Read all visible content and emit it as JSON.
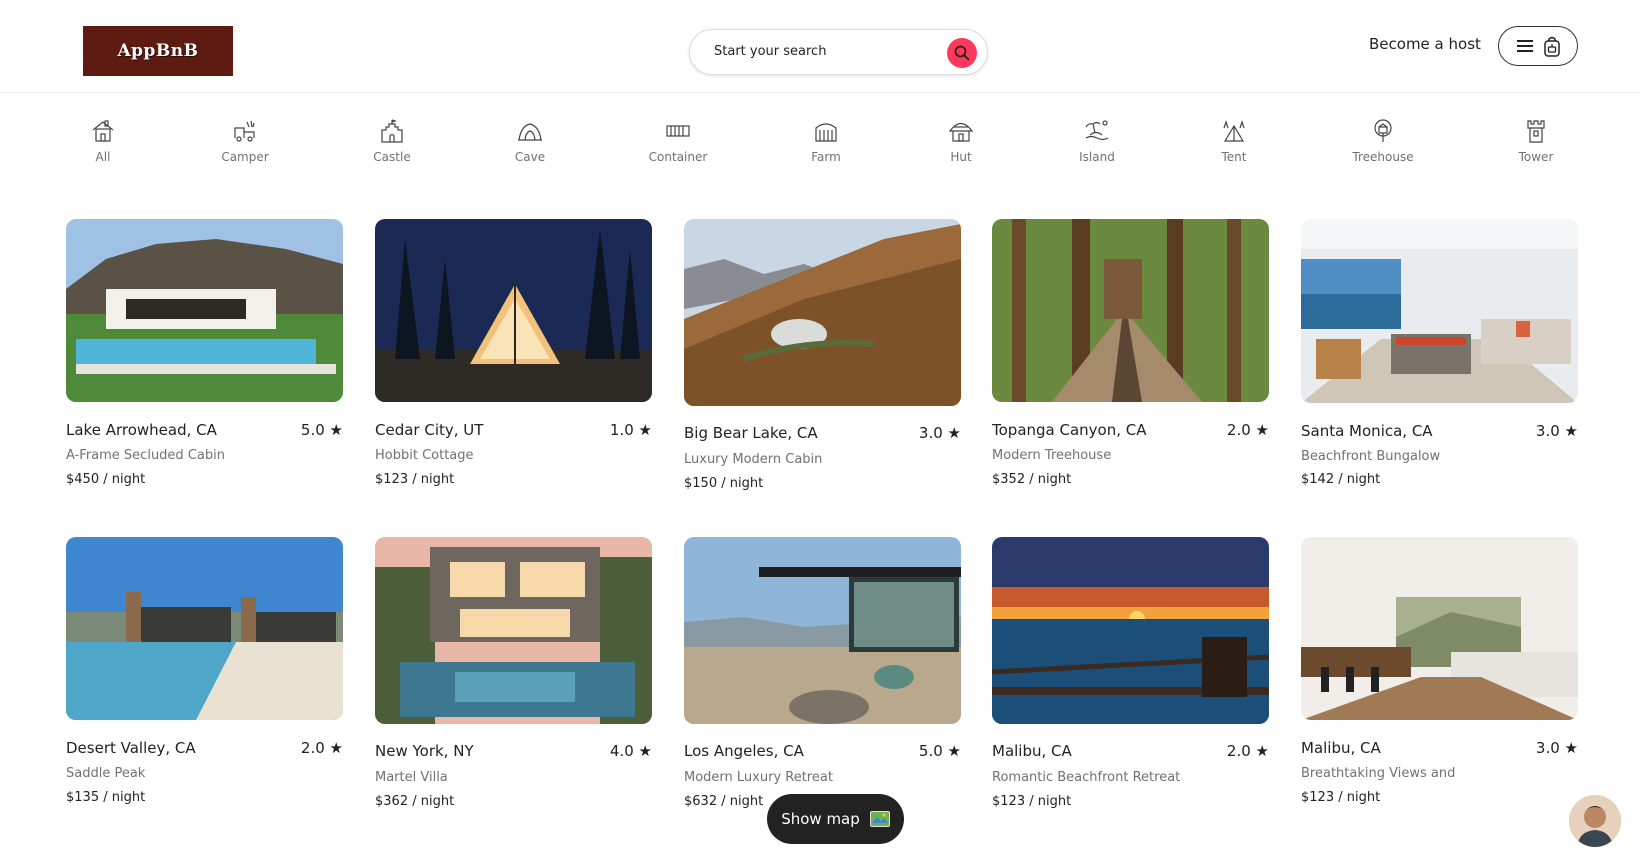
{
  "header": {
    "logo_text": "AppBnB",
    "search_placeholder": "Start your search",
    "become_host": "Become a host"
  },
  "categories": [
    "All",
    "Camper",
    "Castle",
    "Cave",
    "Container",
    "Farm",
    "Hut",
    "Island",
    "Tent",
    "Treehouse",
    "Tower"
  ],
  "listings": [
    {
      "title": "Lake Arrowhead, CA",
      "rating": "5.0",
      "subtitle": "A-Frame Secluded Cabin",
      "price": "$450 / night"
    },
    {
      "title": "Cedar City, UT",
      "rating": "1.0",
      "subtitle": "Hobbit Cottage",
      "price": "$123 / night"
    },
    {
      "title": "Big Bear Lake, CA",
      "rating": "3.0",
      "subtitle": "Luxury Modern Cabin",
      "price": "$150 / night"
    },
    {
      "title": "Topanga Canyon, CA",
      "rating": "2.0",
      "subtitle": "Modern Treehouse",
      "price": "$352 / night"
    },
    {
      "title": "Santa Monica, CA",
      "rating": "3.0",
      "subtitle": "Beachfront Bungalow",
      "price": "$142 / night"
    },
    {
      "title": "Desert Valley, CA",
      "rating": "2.0",
      "subtitle": "Saddle Peak",
      "price": "$135 / night"
    },
    {
      "title": "New York, NY",
      "rating": "4.0",
      "subtitle": "Martel Villa",
      "price": "$362 / night"
    },
    {
      "title": "Los Angeles, CA",
      "rating": "5.0",
      "subtitle": "Modern Luxury Retreat",
      "price": "$632 / night"
    },
    {
      "title": "Malibu, CA",
      "rating": "2.0",
      "subtitle": "Romantic Beachfront Retreat",
      "price": "$123 / night"
    },
    {
      "title": "Malibu, CA",
      "rating": "3.0",
      "subtitle": "Breathtaking Views and",
      "price": "$123 / night"
    }
  ],
  "show_map_label": "Show map",
  "colors": {
    "accent": "#ff385c",
    "logo_bg": "#5e1b12",
    "dark_button": "#222222",
    "muted_text": "#717171"
  }
}
